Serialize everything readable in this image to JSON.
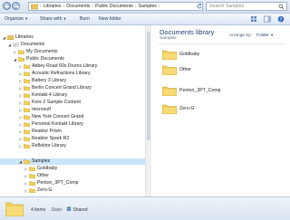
{
  "address": {
    "crumbs": [
      "Libraries",
      "Documents",
      "Public Documents",
      "Samples"
    ],
    "search_placeholder": "Search Samples"
  },
  "toolbar": {
    "organize": "Organize",
    "share_with": "Share with",
    "burn": "Burn",
    "new_folder": "New folder"
  },
  "nav": {
    "libraries": "Libraries",
    "documents": "Documents",
    "my_documents": "My Documents",
    "public_documents": "Public Documents",
    "folders": [
      "Abbey Road 60s Drums Library",
      "Acoustic Refractions Library",
      "Battery 3 Library",
      "Berlin Concert Grand Library",
      "Kontakt 4 Library",
      "Kore 2 Sample Content",
      "microsoft",
      "New York Concert Grand",
      "Personal Kontakt Library",
      "Reaktor Prism",
      "Reaktor Spark R2",
      "Reflektor Library"
    ],
    "samples": "Samples",
    "sample_children": [
      "Goldbaby",
      "Other",
      "Penton_3PT_Comp",
      "Zero-G"
    ]
  },
  "content": {
    "title": "Documents library",
    "subtitle": "Samples",
    "arrange_label": "Arrange by:",
    "arrange_value": "Folder",
    "items": [
      "Goldbaby",
      "Other",
      "Penton_3PT_Comp",
      "Zero-G"
    ]
  },
  "status": {
    "count": "4 items",
    "state_label": "State:",
    "state_value": "Shared"
  }
}
